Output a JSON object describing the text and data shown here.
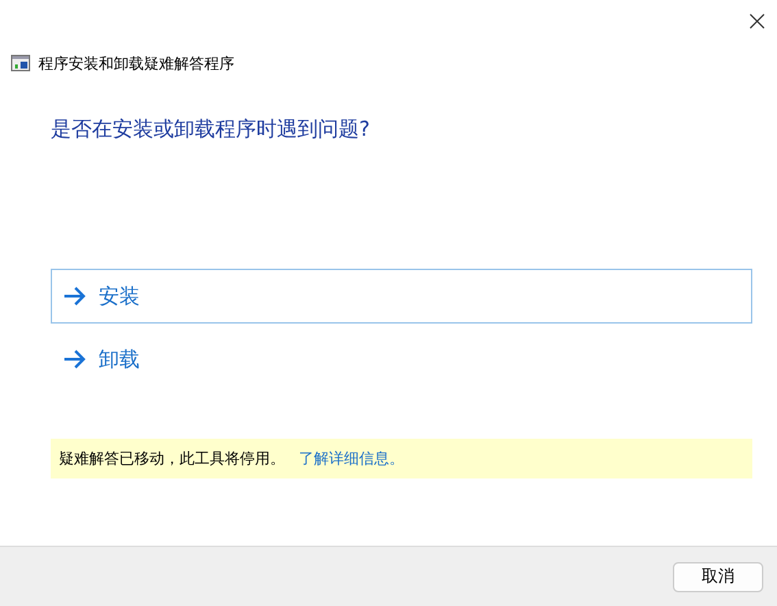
{
  "window": {
    "title": "程序安装和卸载疑难解答程序"
  },
  "heading": "是否在安装或卸载程序时遇到问题?",
  "options": [
    {
      "label": "安装",
      "selected": true
    },
    {
      "label": "卸载",
      "selected": false
    }
  ],
  "notice": {
    "text": "疑难解答已移动，此工具将停用。",
    "link": "了解详细信息。"
  },
  "buttons": [
    "取消"
  ]
}
